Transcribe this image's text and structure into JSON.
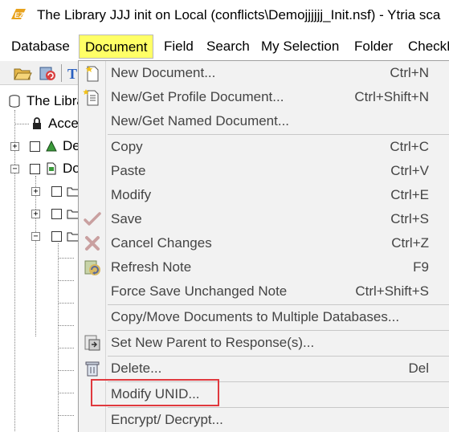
{
  "window": {
    "title": "The Library JJJ init on Local (conflicts\\Demojjjjjj_Init.nsf) - Ytria sca",
    "logo_text": "EZ"
  },
  "menubar": {
    "items": [
      {
        "label": "Database"
      },
      {
        "label": "Document"
      },
      {
        "label": "Field"
      },
      {
        "label": "Search"
      },
      {
        "label": "My Selection"
      },
      {
        "label": "Folder"
      },
      {
        "label": "CheckB"
      }
    ]
  },
  "tree": {
    "root_label": "The Libra",
    "access_label": "Acce",
    "item_de": "De",
    "item_do": "Do"
  },
  "document_menu": {
    "items": [
      {
        "label": "New Document...",
        "shortcut": "Ctrl+N",
        "icon": "new-document-icon"
      },
      {
        "label": "New/Get Profile Document...",
        "shortcut": "Ctrl+Shift+N",
        "icon": "profile-document-icon"
      },
      {
        "label": "New/Get Named Document...",
        "shortcut": "",
        "icon": ""
      },
      {
        "label": "Copy",
        "shortcut": "Ctrl+C",
        "icon": ""
      },
      {
        "label": "Paste",
        "shortcut": "Ctrl+V",
        "icon": ""
      },
      {
        "label": "Modify",
        "shortcut": "Ctrl+E",
        "icon": ""
      },
      {
        "label": "Save",
        "shortcut": "Ctrl+S",
        "icon": "checkmark-icon"
      },
      {
        "label": "Cancel Changes",
        "shortcut": "Ctrl+Z",
        "icon": "cross-icon"
      },
      {
        "label": "Refresh Note",
        "shortcut": "F9",
        "icon": "refresh-icon"
      },
      {
        "label": "Force Save Unchanged Note",
        "shortcut": "Ctrl+Shift+S",
        "icon": ""
      },
      {
        "label": "Copy/Move Documents to Multiple Databases...",
        "shortcut": "",
        "icon": ""
      },
      {
        "label": "Set New Parent to Response(s)...",
        "shortcut": "",
        "icon": "parent-link-icon"
      },
      {
        "label": "Delete...",
        "shortcut": "Del",
        "icon": "trash-icon"
      },
      {
        "label": "Modify UNID...",
        "shortcut": "",
        "icon": ""
      },
      {
        "label": "Encrypt/ Decrypt...",
        "shortcut": "",
        "icon": ""
      }
    ]
  },
  "colors": {
    "menu_active_bg": "#ffff66",
    "highlight_border": "#e0393e",
    "menu_bg": "#f2f2f2"
  }
}
